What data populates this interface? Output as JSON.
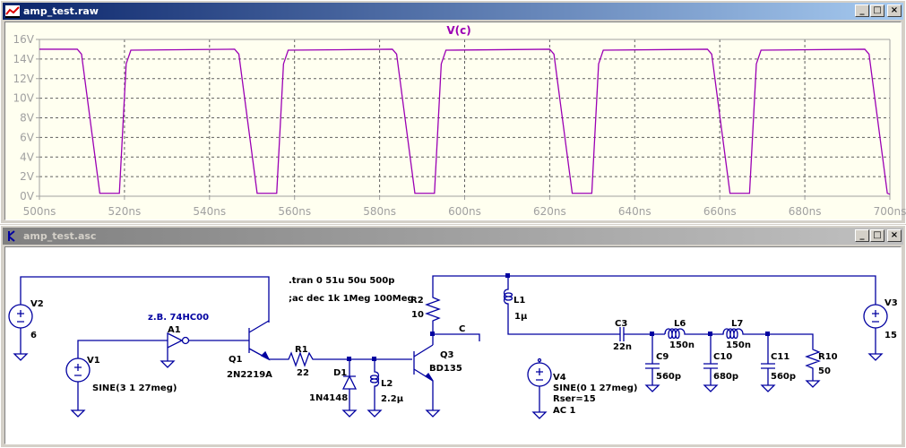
{
  "waveform_window": {
    "title": "amp_test.raw",
    "buttons": [
      "_",
      "□",
      "×"
    ]
  },
  "schematic_window": {
    "title": "amp_test.asc",
    "buttons": [
      "_",
      "□",
      "×"
    ]
  },
  "chart_data": {
    "type": "line",
    "title": "V(c)",
    "xlabel": "",
    "ylabel": "",
    "xlim": [
      500,
      700
    ],
    "ylim": [
      0,
      16
    ],
    "x_unit": "ns",
    "y_unit": "V",
    "xticks": [
      "500ns",
      "520ns",
      "540ns",
      "560ns",
      "580ns",
      "600ns",
      "620ns",
      "640ns",
      "660ns",
      "680ns",
      "700ns"
    ],
    "yticks": [
      "0V",
      "2V",
      "4V",
      "6V",
      "8V",
      "10V",
      "12V",
      "14V",
      "16V"
    ],
    "grid": true,
    "colors": {
      "trace": "#9b00b4",
      "grid": "#606060",
      "axis": "#a0a0a0",
      "background": "#fffff0"
    },
    "series": [
      {
        "name": "V(c)",
        "points": [
          [
            500,
            15
          ],
          [
            508.9,
            15
          ],
          [
            509.9,
            14.5
          ],
          [
            514.2,
            0.3
          ],
          [
            518.8,
            0.3
          ],
          [
            520.4,
            13.5
          ],
          [
            521.5,
            14.9
          ],
          [
            545.9,
            15
          ],
          [
            546.9,
            14.5
          ],
          [
            551.2,
            0.3
          ],
          [
            555.8,
            0.3
          ],
          [
            557.4,
            13.5
          ],
          [
            558.5,
            14.9
          ],
          [
            583,
            15
          ],
          [
            584,
            14.5
          ],
          [
            588.3,
            0.3
          ],
          [
            592.9,
            0.3
          ],
          [
            594.5,
            13.5
          ],
          [
            595.6,
            14.9
          ],
          [
            620,
            15
          ],
          [
            621,
            14.5
          ],
          [
            625.3,
            0.3
          ],
          [
            629.9,
            0.3
          ],
          [
            631.5,
            13.5
          ],
          [
            632.6,
            14.9
          ],
          [
            657.1,
            15
          ],
          [
            658.1,
            14.5
          ],
          [
            662.4,
            0.3
          ],
          [
            667,
            0.3
          ],
          [
            668.6,
            13.5
          ],
          [
            669.7,
            14.9
          ],
          [
            694.1,
            15
          ],
          [
            695.1,
            14.5
          ],
          [
            699.4,
            0.3
          ],
          [
            700,
            0.2
          ]
        ]
      }
    ]
  },
  "schematic": {
    "directives": [
      ".tran 0 51u 50u 500p",
      ";ac dec 1k 1Meg 100Meg"
    ],
    "V2": {
      "name": "V2",
      "value": "6"
    },
    "V1": {
      "name": "V1",
      "value": "SINE(3 1 27meg)"
    },
    "A1": {
      "name": "A1",
      "note": "z.B. 74HC00"
    },
    "Q1": {
      "name": "Q1",
      "value": "2N2219A"
    },
    "R1": {
      "name": "R1",
      "value": "22"
    },
    "D1": {
      "name": "D1",
      "value": "1N4148"
    },
    "L2": {
      "name": "L2",
      "value": "2.2µ"
    },
    "Q3": {
      "name": "Q3",
      "value": "BD135"
    },
    "R2": {
      "name": "R2",
      "value": "10"
    },
    "net_c": "C",
    "L1": {
      "name": "L1",
      "value": "1µ"
    },
    "C3": {
      "name": "C3",
      "value": "22n"
    },
    "L6": {
      "name": "L6",
      "value": "150n"
    },
    "L7": {
      "name": "L7",
      "value": "150n"
    },
    "C9": {
      "name": "C9",
      "value": "560p"
    },
    "C10": {
      "name": "C10",
      "value": "680p"
    },
    "C11": {
      "name": "C11",
      "value": "560p"
    },
    "R10": {
      "name": "R10",
      "value": "50"
    },
    "V4": {
      "name": "V4",
      "value": "SINE(0 1 27meg)",
      "rser": "Rser=15",
      "ac": "AC 1"
    },
    "V3": {
      "name": "V3",
      "value": "15"
    },
    "wire_color": "#0000a0",
    "note_color": "#0000a0"
  }
}
